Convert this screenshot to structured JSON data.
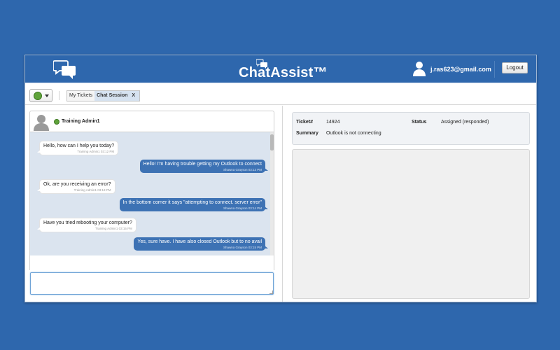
{
  "header": {
    "app_name": "ChatAssist™",
    "user_email": "j.ras623@gmail.com",
    "logout_label": "Logout"
  },
  "toolbar": {
    "status_color": "#5fa33a",
    "tabs": [
      {
        "label": "My Tickets",
        "active": false
      },
      {
        "label": "Chat Session",
        "active": true
      }
    ],
    "tab_close": "X"
  },
  "chat": {
    "contact_name": "Training Admin1",
    "messages": [
      {
        "direction": "in",
        "text": "Hello, how can I help you today?",
        "meta": "Training Admin1 03:12 PM"
      },
      {
        "direction": "out",
        "text": "Hello! I'm having trouble getting my Outlook to connect",
        "meta": "Shawna Grayson 03:13 PM"
      },
      {
        "direction": "in",
        "text": "Ok, are you receiving an error?",
        "meta": "Training Admin1 03:13 PM"
      },
      {
        "direction": "out",
        "text": "In the bottom corner it says \"attempting to connect. server error\"",
        "meta": "Shawna Grayson 03:14 PM"
      },
      {
        "direction": "in",
        "text": "Have you tried rebooting your computer?",
        "meta": "Training Admin1 03:15 PM"
      },
      {
        "direction": "out",
        "text": "Yes, sure have. I have also closed Outlook but to no avail",
        "meta": "Shawna Grayson 03:15 PM"
      }
    ],
    "input_value": ""
  },
  "ticket": {
    "ticket_label": "Ticket#",
    "ticket_value": "14924",
    "status_label": "Status",
    "status_value": "Assigned (responded)",
    "summary_label": "Summary",
    "summary_value": "Outlook is not connecting"
  },
  "colors": {
    "brand_blue": "#2e67ad",
    "outgoing_bubble": "#3d72b4",
    "chat_background": "#dbe4ef",
    "online_green": "#5fa33a"
  }
}
